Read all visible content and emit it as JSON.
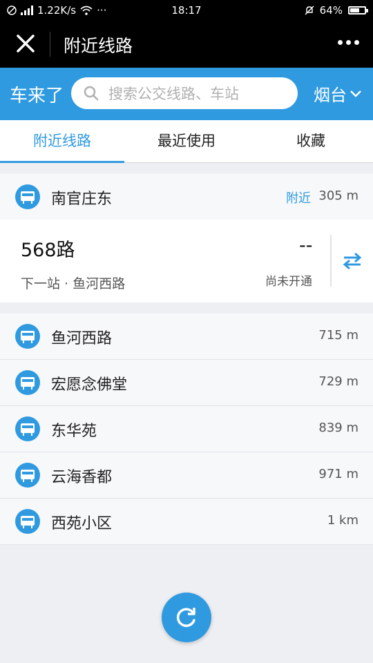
{
  "status_bar": {
    "network_speed": "1.22K/s",
    "time": "18:17",
    "battery": "64%",
    "battery_level": 0.64
  },
  "title_bar": {
    "title": "附近线路"
  },
  "search": {
    "brand": "车来了",
    "placeholder": "搜索公交线路、车站",
    "city": "烟台"
  },
  "tabs": [
    {
      "label": "附近线路",
      "active": true
    },
    {
      "label": "最近使用",
      "active": false
    },
    {
      "label": "收藏",
      "active": false
    }
  ],
  "nearest_station": {
    "name": "南官庄东",
    "badge": "附近",
    "distance": "305 m"
  },
  "route": {
    "name": "568路",
    "next_stop": "下一站 · 鱼河西路",
    "arrival": "--",
    "status": "尚未开通"
  },
  "stations": [
    {
      "name": "鱼河西路",
      "distance": "715 m"
    },
    {
      "name": "宏愿念佛堂",
      "distance": "729 m"
    },
    {
      "name": "东华苑",
      "distance": "839 m"
    },
    {
      "name": "云海香都",
      "distance": "971 m"
    },
    {
      "name": "西苑小区",
      "distance": "1 km"
    }
  ],
  "icons": {
    "bus_station": "bus-station-icon",
    "refresh": "refresh-icon",
    "swap": "swap-direction-icon"
  },
  "colors": {
    "accent": "#2f9ae0",
    "title_bar": "#000000"
  }
}
